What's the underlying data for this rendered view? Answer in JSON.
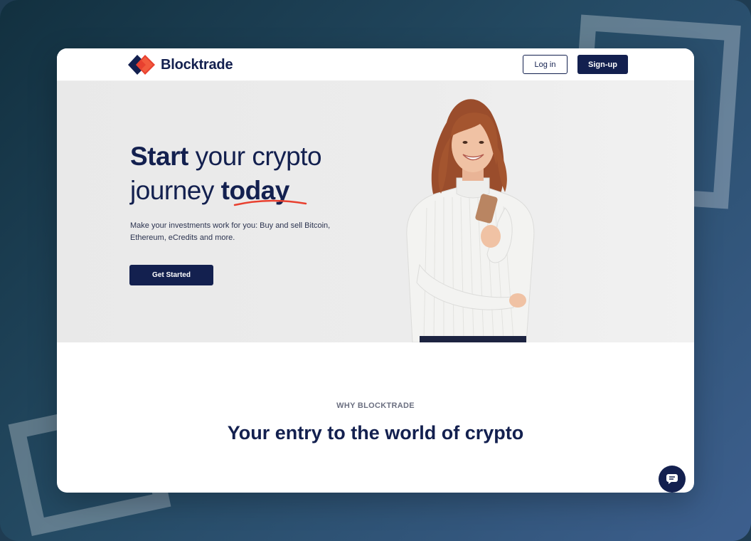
{
  "navbar": {
    "brand": "Blocktrade",
    "login_label": "Log in",
    "signup_label": "Sign-up"
  },
  "hero": {
    "title_bold_1": "Start",
    "title_plain_1": " your crypto",
    "title_plain_2": "journey ",
    "title_bold_2": "today",
    "subtitle": "Make your investments work for you: Buy and sell Bitcoin, Ethereum, eCredits and more.",
    "cta_label": "Get Started"
  },
  "why": {
    "label": "WHY BLOCKTRADE",
    "title": "Your entry to the world of crypto"
  },
  "icons": {
    "logo": "blocktrade-logo-icon",
    "chat": "chat-bubble-icon"
  },
  "colors": {
    "brand_navy": "#13204f",
    "accent_red": "#e8402f",
    "hero_bg": "#ececec"
  }
}
